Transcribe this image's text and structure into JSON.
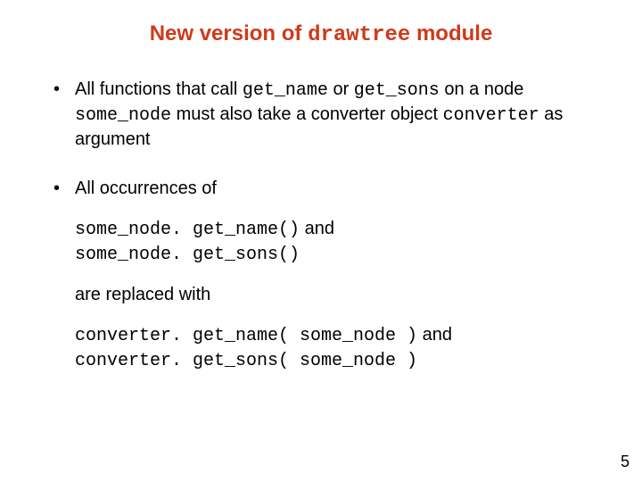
{
  "title": {
    "pre": "New version of ",
    "code": "drawtree",
    "post": " module"
  },
  "bullet1": {
    "t1": "All functions that call ",
    "c1": "get_name",
    "t2": " or ",
    "c2": "get_sons",
    "t3": " on a node ",
    "c3": "some_node",
    "t4": " must also take a converter object ",
    "c4": "converter",
    "t5": " as argument"
  },
  "bullet2": {
    "lead": "All occurrences of",
    "line1_code": "some_node. get_name()",
    "line1_tail": " and",
    "line2_code": "some_node. get_sons()",
    "mid": "are replaced with",
    "line3_code": "converter. get_name( some_node )",
    "line3_tail": " and",
    "line4_code": "converter. get_sons( some_node )"
  },
  "pagenum": "5"
}
